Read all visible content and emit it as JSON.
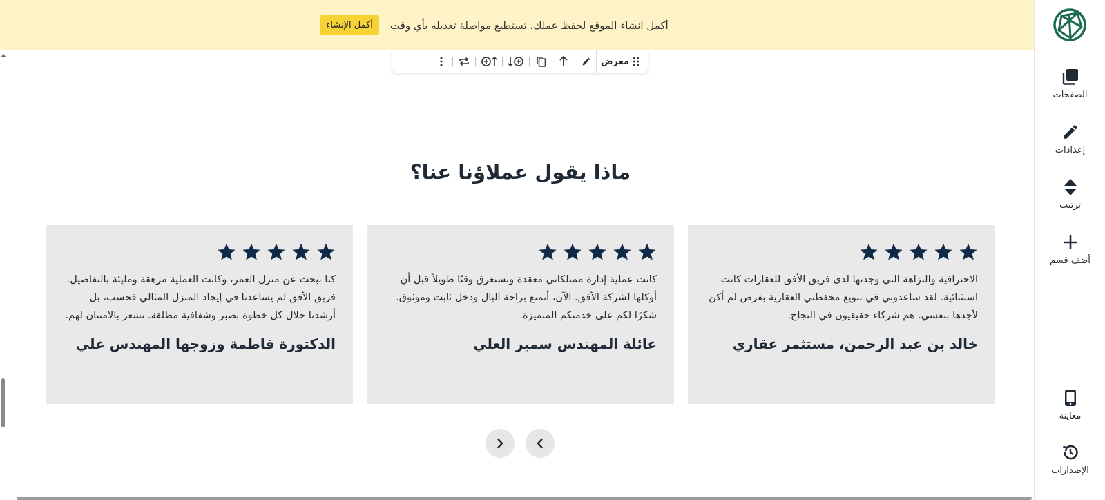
{
  "banner": {
    "message": "أكمل انشاء الموقع لحفظ عملك، تستطيع مواصلة تعديله بأي وقت",
    "button_label": "أكمل الإنشاء"
  },
  "toolbar": {
    "section_label": "معرض"
  },
  "sidebar": {
    "pages_label": "الصفحات",
    "settings_label": "إعدادات",
    "order_label": "ترتيب",
    "add_section_label": "أضف قسم",
    "preview_label": "معاينة",
    "versions_label": "الإصدارات"
  },
  "section": {
    "title": "ماذا يقول عملاؤنا عنا؟"
  },
  "testimonials": [
    {
      "rating": 5,
      "quote": "الاحترافية والنزاهة التي وجدتها لدى فريق الأفق للعقارات كانت استثنائية. لقد ساعدوني في تنويع محفظتي العقارية بفرص لم أكن لأجدها بنفسي. هم شركاء حقيقيون في النجاح.",
      "author": "خالد بن عبد الرحمن، مستثمر عقاري"
    },
    {
      "rating": 5,
      "quote": "كانت عملية إدارة ممتلكاتي معقدة وتستغرق وقتًا طويلاً قبل أن أوكلها لشركة الأفق. الآن، أتمتع براحة البال ودخل ثابت وموثوق. شكرًا لكم على خدمتكم المتميزة.",
      "author": "عائلة المهندس سمير العلي"
    },
    {
      "rating": 5,
      "quote": "كنا نبحث عن منزل العمر، وكانت العملية مرهقة ومليئة بالتفاصيل. فريق الأفق لم يساعدنا في إيجاد المنزل المثالي فحسب، بل أرشدنا خلال كل خطوة بصبر وشفافية مطلقة. نشعر بالامتنان لهم.",
      "author": "الدكتورة فاطمة وزوجها المهندس علي"
    }
  ],
  "colors": {
    "banner_bg": "#fdf3c6",
    "banner_button": "#f7d234",
    "brand_green": "#1b6b52",
    "star": "#0f2a47",
    "card_bg": "#e9e9e9"
  }
}
